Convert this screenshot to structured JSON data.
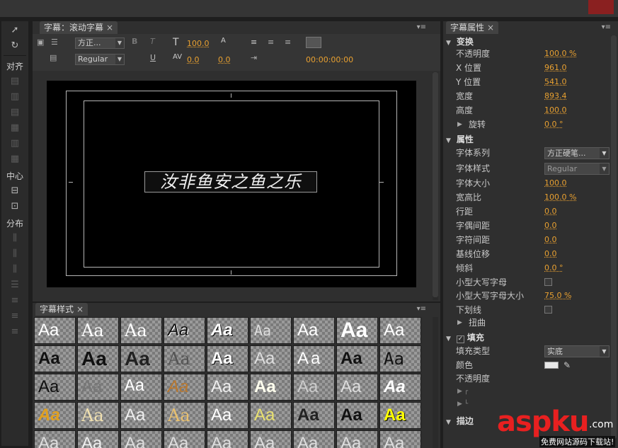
{
  "toolbox": {
    "align_label": "对齐",
    "center_label": "中心",
    "distribute_label": "分布"
  },
  "title_panel": {
    "tab_label": "字幕：滚动字幕",
    "font_family_value": "方正...",
    "font_style_value": "Regular",
    "font_size": "100.0",
    "leading_value": "0.0",
    "kerning_value": "0.0",
    "timecode": "00:00:00:00",
    "title_text": "汝非鱼安之鱼之乐"
  },
  "styles_panel": {
    "tab_label": "字幕样式",
    "swatch_text": "Aa"
  },
  "props_panel": {
    "tab_label": "字幕属性",
    "sections": {
      "transform": "变换",
      "properties": "属性",
      "fill": "填充",
      "stroke": "描边"
    },
    "rows": {
      "opacity": {
        "label": "不透明度",
        "value": "100.0 %"
      },
      "x_pos": {
        "label": "X 位置",
        "value": "961.0"
      },
      "y_pos": {
        "label": "Y 位置",
        "value": "541.0"
      },
      "width": {
        "label": "宽度",
        "value": "893.4"
      },
      "height": {
        "label": "高度",
        "value": "100.0"
      },
      "rotation": {
        "label": "旋转",
        "value": "0.0 °"
      },
      "font_family": {
        "label": "字体系列",
        "value": "方正硬笔..."
      },
      "font_style": {
        "label": "字体样式",
        "value": "Regular"
      },
      "font_size": {
        "label": "字体大小",
        "value": "100.0"
      },
      "aspect": {
        "label": "宽高比",
        "value": "100.0 %"
      },
      "leading": {
        "label": "行距",
        "value": "0.0"
      },
      "kerning": {
        "label": "字偶间距",
        "value": "0.0"
      },
      "tracking": {
        "label": "字符间距",
        "value": "0.0"
      },
      "baseline": {
        "label": "基线位移",
        "value": "0.0"
      },
      "slant": {
        "label": "倾斜",
        "value": "0.0 °"
      },
      "small_caps": {
        "label": "小型大写字母"
      },
      "small_caps_size": {
        "label": "小型大写字母大小",
        "value": "75.0 %"
      },
      "underline": {
        "label": "下划线"
      },
      "distort": {
        "label": "扭曲"
      },
      "fill_type": {
        "label": "填充类型",
        "value": "实底"
      },
      "color": {
        "label": "颜色"
      },
      "fill_opacity": {
        "label": "不透明度"
      }
    }
  },
  "watermark": {
    "brand": "aspku",
    "suffix": ".com",
    "sub": "免费网站源码下载站!"
  },
  "colors": {
    "accent": "#e8a030",
    "panel": "#2f2f2f",
    "canvas": "#000000"
  }
}
